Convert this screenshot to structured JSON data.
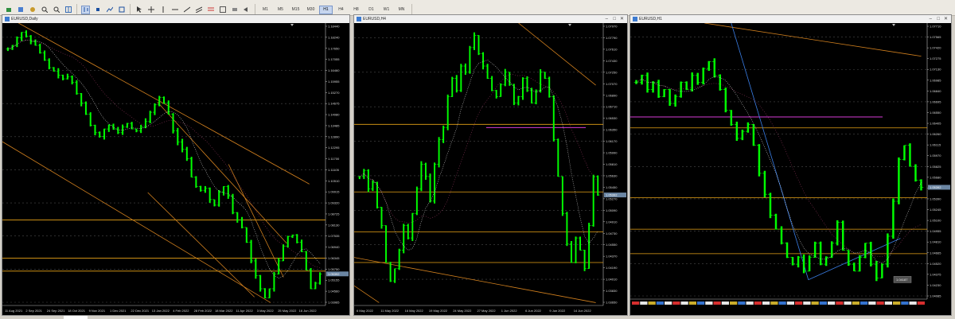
{
  "colors": {
    "candle": "#00ff00",
    "level": "#e8a317",
    "trend": "#d2801e",
    "grid": "#4a4a4a",
    "magenta": "#d63bd6",
    "blue": "#3a7ee6",
    "price_tag": "#6b86a3"
  },
  "toolbar": {
    "timeframes": [
      {
        "label": "M1"
      },
      {
        "label": "M5"
      },
      {
        "label": "M15"
      },
      {
        "label": "M30"
      },
      {
        "label": "H1",
        "active": true
      },
      {
        "label": "H4"
      },
      {
        "label": "H8"
      },
      {
        "label": "D1"
      },
      {
        "label": "W1"
      },
      {
        "label": "MN"
      }
    ]
  },
  "windows": [
    {
      "id": "daily",
      "title": "EURUSD,Daily",
      "yticks": [
        "1.18440",
        "1.18240",
        "1.17650",
        "1.17055",
        "1.16460",
        "1.15955",
        "1.15270",
        "1.14675",
        "1.14080",
        "1.13485",
        "1.12890",
        "1.12295",
        "1.11700",
        "1.11105",
        "1.10510",
        "1.09915",
        "1.09320",
        "1.08725",
        "1.08130",
        "1.07535",
        "1.06940",
        "1.06345",
        "1.05750",
        "1.05155",
        "1.04560",
        "1.03965"
      ],
      "xticks": [
        "11 Aug 2021",
        "2 Sep 2021",
        "24 Sep 2021",
        "18 Oct 2021",
        "9 Nov 2021",
        "1 Dec 2021",
        "22 Dec 2021",
        "13 Jan 2022",
        "4 Feb 2022",
        "28 Feb 2022",
        "18 Mar 2022",
        "11 Apr 2022",
        "3 May 2022",
        "25 May 2022",
        "16 Jun 2022"
      ],
      "price_tag": "1.05392",
      "levels": [
        1.082,
        1.0615,
        1.0545
      ],
      "ymin": 1.036,
      "ymax": 1.188,
      "series": [
        1.174,
        1.176,
        1.18,
        1.183,
        1.181,
        1.178,
        1.176,
        1.172,
        1.168,
        1.164,
        1.162,
        1.16,
        1.158,
        1.159,
        1.156,
        1.15,
        1.145,
        1.139,
        1.133,
        1.129,
        1.127,
        1.131,
        1.133,
        1.131,
        1.129,
        1.132,
        1.134,
        1.131,
        1.13,
        1.132,
        1.135,
        1.14,
        1.144,
        1.148,
        1.145,
        1.139,
        1.13,
        1.124,
        1.12,
        1.115,
        1.105,
        1.1,
        1.098,
        1.099,
        1.093,
        1.09,
        1.097,
        1.1,
        1.095,
        1.086,
        1.082,
        1.078,
        1.07,
        1.06,
        1.052,
        1.045,
        1.04,
        1.045,
        1.053,
        1.06,
        1.068,
        1.073,
        1.074,
        1.07,
        1.065,
        1.055,
        1.045,
        1.048,
        1.053
      ]
    },
    {
      "id": "h4",
      "title": "EURUSD,H4",
      "yticks": [
        "1.07970",
        "1.07790",
        "1.07610",
        "1.07430",
        "1.07250",
        "1.07070",
        "1.06890",
        "1.06710",
        "1.06530",
        "1.06350",
        "1.06170",
        "1.05990",
        "1.05810",
        "1.05630",
        "1.05450",
        "1.05270",
        "1.05090",
        "1.04910",
        "1.04730",
        "1.04550",
        "1.04370",
        "1.04190",
        "1.04010",
        "1.03830",
        "1.03650"
      ],
      "xticks": [
        "6 May 2022",
        "11 May 2022",
        "16 May 2022",
        "19 May 2022",
        "24 May 2022",
        "27 May 2022",
        "1 Jun 2022",
        "6 Jun 2022",
        "9 Jun 2022",
        "14 Jun 2022"
      ],
      "price_tag": "1.05392",
      "levels": [
        1.0645,
        1.0535,
        1.047,
        1.042
      ],
      "ymin": 1.035,
      "ymax": 1.081,
      "series": [
        1.056,
        1.057,
        1.054,
        1.055,
        1.051,
        1.048,
        1.042,
        1.039,
        1.041,
        1.044,
        1.048,
        1.046,
        1.05,
        1.054,
        1.058,
        1.056,
        1.052,
        1.058,
        1.062,
        1.064,
        1.069,
        1.072,
        1.07,
        1.074,
        1.073,
        1.077,
        1.079,
        1.076,
        1.074,
        1.072,
        1.07,
        1.069,
        1.071,
        1.073,
        1.071,
        1.068,
        1.069,
        1.072,
        1.07,
        1.068,
        1.07,
        1.073,
        1.072,
        1.069,
        1.062,
        1.056,
        1.05,
        1.045,
        1.042,
        1.046,
        1.044,
        1.041,
        1.048,
        1.056,
        1.053
      ]
    },
    {
      "id": "h1",
      "title": "EURUSD,H1",
      "yticks": [
        "1.07710",
        "1.07565",
        "1.07420",
        "1.07275",
        "1.07130",
        "1.06985",
        "1.06840",
        "1.06695",
        "1.06550",
        "1.06405",
        "1.06260",
        "1.06115",
        "1.05970",
        "1.05825",
        "1.05680",
        "1.05535",
        "1.05390",
        "1.05245",
        "1.05100",
        "1.04955",
        "1.04810",
        "1.04665",
        "1.04520",
        "1.04375",
        "1.04230",
        "1.04085"
      ],
      "xticks": [],
      "price_tag": "1.05392",
      "levels": [
        1.0635,
        1.0535,
        1.049,
        1.0455
      ],
      "ymin": 1.039,
      "ymax": 1.0785,
      "series": [
        1.07,
        1.071,
        1.069,
        1.07,
        1.068,
        1.069,
        1.067,
        1.068,
        1.07,
        1.069,
        1.071,
        1.07,
        1.072,
        1.073,
        1.071,
        1.069,
        1.066,
        1.064,
        1.062,
        1.063,
        1.064,
        1.061,
        1.057,
        1.054,
        1.051,
        1.049,
        1.047,
        1.045,
        1.044,
        1.045,
        1.043,
        1.045,
        1.047,
        1.044,
        1.045,
        1.047,
        1.05,
        1.046,
        1.044,
        1.043,
        1.045,
        1.047,
        1.044,
        1.042,
        1.044,
        1.048,
        1.053,
        1.059,
        1.061,
        1.058,
        1.056,
        1.055
      ]
    }
  ],
  "h1_label_box": "1.04187"
}
